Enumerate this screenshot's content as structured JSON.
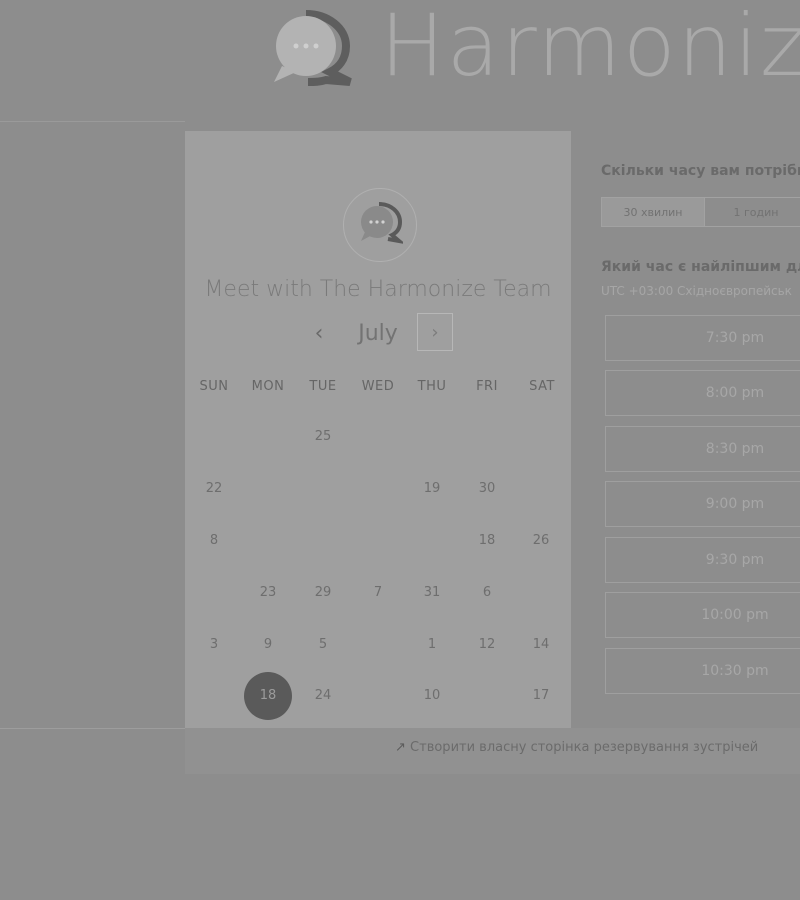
{
  "header": {
    "brand": "Harmoniz"
  },
  "card": {
    "title": "Meet with The Harmonize Team",
    "month": "July",
    "prev": "‹",
    "next": "›",
    "weekdays": [
      "SUN",
      "MON",
      "TUE",
      "WED",
      "THU",
      "FRI",
      "SAT"
    ],
    "selected_day": "18"
  },
  "days": [
    "25",
    "22",
    "19",
    "30",
    "8",
    "18",
    "26",
    "23",
    "29",
    "7",
    "31",
    "6",
    "3",
    "9",
    "5",
    "1",
    "12",
    "14",
    "18",
    "24",
    "10",
    "17"
  ],
  "right": {
    "duration_question": "Скільки часу вам потрібно",
    "durations": [
      "30 хвилин",
      "1 годин"
    ],
    "time_question": "Який час є найліпшим для",
    "timezone": "UTC +03:00 Східноєвропейськ",
    "slots": [
      "7:30 pm",
      "8:00 pm",
      "8:30 pm",
      "9:00 pm",
      "9:30 pm",
      "10:00 pm",
      "10:30 pm"
    ]
  },
  "footer": {
    "link": "Створити власну сторінка резервування зустрічей"
  },
  "colors": {
    "background": "#8d8d8d",
    "card": "#9f9f9f",
    "selected": "#5a5a5a"
  }
}
